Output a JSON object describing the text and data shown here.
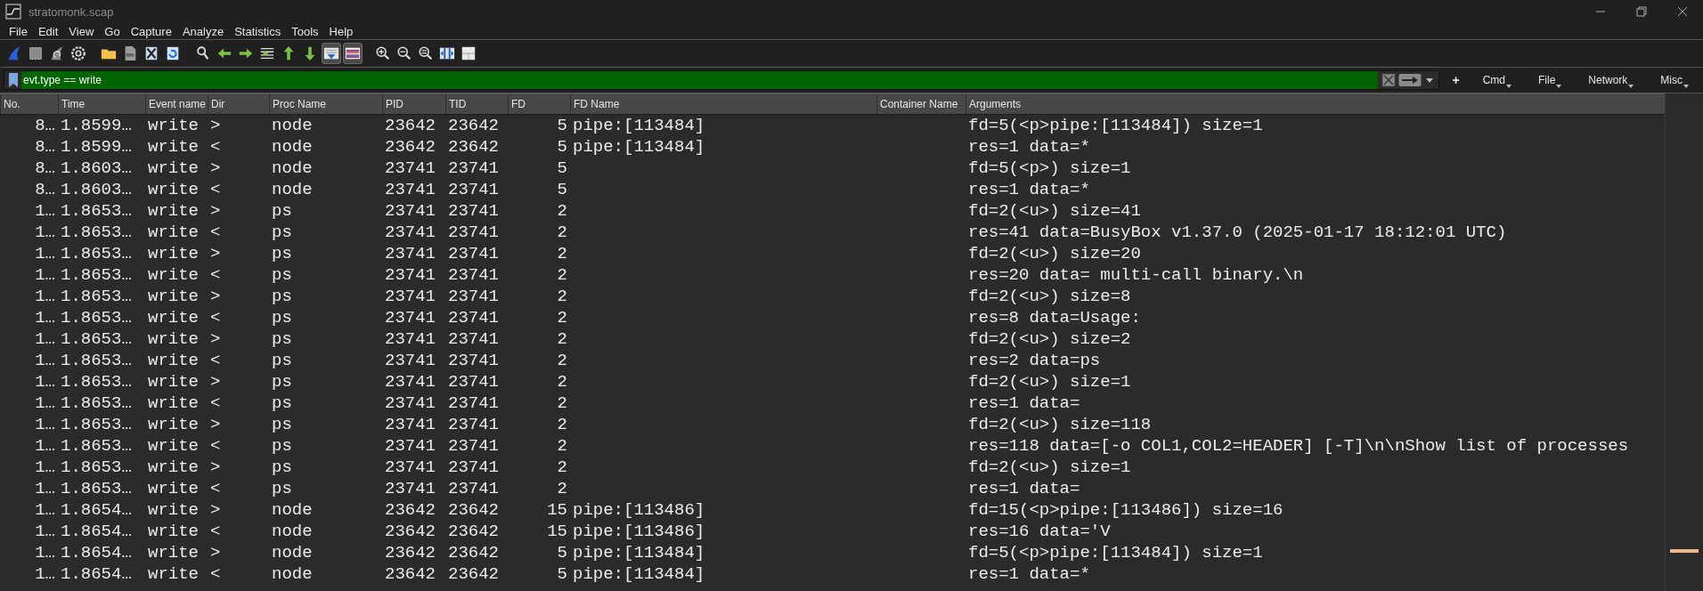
{
  "window": {
    "title": "stratomonk.scap"
  },
  "menu": [
    "File",
    "Edit",
    "View",
    "Go",
    "Capture",
    "Analyze",
    "Statistics",
    "Tools",
    "Help"
  ],
  "toolbar": [
    {
      "pressed": false
    },
    {
      "pressed": false
    },
    {
      "pressed": false
    },
    {
      "pressed": false
    },
    {
      "pressed": false
    },
    {
      "pressed": false
    },
    {
      "pressed": false
    },
    {
      "pressed": false
    },
    {
      "pressed": false
    },
    {
      "pressed": false
    },
    {
      "pressed": false
    },
    {
      "pressed": false
    },
    {
      "pressed": false
    },
    {
      "pressed": false
    },
    {
      "pressed": true
    },
    {
      "pressed": true
    },
    {
      "pressed": false
    },
    {
      "pressed": false
    },
    {
      "pressed": false
    },
    {
      "pressed": false
    },
    {
      "pressed": false
    }
  ],
  "filter": {
    "value": "evt.type == write",
    "add_label": "+",
    "buttons": [
      "Cmd",
      "File",
      "Network",
      "Misc"
    ]
  },
  "table": {
    "columns": [
      "No.",
      "Time",
      "Event name",
      "Dir",
      "Proc Name",
      "PID",
      "TID",
      "FD",
      "FD Name",
      "Container Name",
      "Arguments"
    ],
    "rows": [
      {
        "no": "8…",
        "time": "1.8599…",
        "event": "write",
        "dir": ">",
        "proc": "node",
        "pid": "23642",
        "tid": "23642",
        "fd": "5",
        "fd_name": "pipe:[113484]",
        "args": "fd=5(<p>pipe:[113484]) size=1"
      },
      {
        "no": "8…",
        "time": "1.8599…",
        "event": "write",
        "dir": "<",
        "proc": "node",
        "pid": "23642",
        "tid": "23642",
        "fd": "5",
        "fd_name": "pipe:[113484]",
        "args": "res=1 data=*"
      },
      {
        "no": "8…",
        "time": "1.8603…",
        "event": "write",
        "dir": ">",
        "proc": "node",
        "pid": "23741",
        "tid": "23741",
        "fd": "5",
        "args": "fd=5(<p>) size=1"
      },
      {
        "no": "8…",
        "time": "1.8603…",
        "event": "write",
        "dir": "<",
        "proc": "node",
        "pid": "23741",
        "tid": "23741",
        "fd": "5",
        "args": "res=1 data=*"
      },
      {
        "no": "1…",
        "time": "1.8653…",
        "event": "write",
        "dir": ">",
        "proc": "ps",
        "pid": "23741",
        "tid": "23741",
        "fd": "2",
        "args": "fd=2(<u>) size=41"
      },
      {
        "no": "1…",
        "time": "1.8653…",
        "event": "write",
        "dir": "<",
        "proc": "ps",
        "pid": "23741",
        "tid": "23741",
        "fd": "2",
        "args": "res=41 data=BusyBox v1.37.0 (2025-01-17 18:12:01 UTC)"
      },
      {
        "no": "1…",
        "time": "1.8653…",
        "event": "write",
        "dir": ">",
        "proc": "ps",
        "pid": "23741",
        "tid": "23741",
        "fd": "2",
        "args": "fd=2(<u>) size=20"
      },
      {
        "no": "1…",
        "time": "1.8653…",
        "event": "write",
        "dir": "<",
        "proc": "ps",
        "pid": "23741",
        "tid": "23741",
        "fd": "2",
        "args": "res=20 data= multi-call binary.\\n"
      },
      {
        "no": "1…",
        "time": "1.8653…",
        "event": "write",
        "dir": ">",
        "proc": "ps",
        "pid": "23741",
        "tid": "23741",
        "fd": "2",
        "args": "fd=2(<u>) size=8"
      },
      {
        "no": "1…",
        "time": "1.8653…",
        "event": "write",
        "dir": "<",
        "proc": "ps",
        "pid": "23741",
        "tid": "23741",
        "fd": "2",
        "args": "res=8 data=Usage:"
      },
      {
        "no": "1…",
        "time": "1.8653…",
        "event": "write",
        "dir": ">",
        "proc": "ps",
        "pid": "23741",
        "tid": "23741",
        "fd": "2",
        "args": "fd=2(<u>) size=2"
      },
      {
        "no": "1…",
        "time": "1.8653…",
        "event": "write",
        "dir": "<",
        "proc": "ps",
        "pid": "23741",
        "tid": "23741",
        "fd": "2",
        "args": "res=2 data=ps"
      },
      {
        "no": "1…",
        "time": "1.8653…",
        "event": "write",
        "dir": ">",
        "proc": "ps",
        "pid": "23741",
        "tid": "23741",
        "fd": "2",
        "args": "fd=2(<u>) size=1"
      },
      {
        "no": "1…",
        "time": "1.8653…",
        "event": "write",
        "dir": "<",
        "proc": "ps",
        "pid": "23741",
        "tid": "23741",
        "fd": "2",
        "args": "res=1 data="
      },
      {
        "no": "1…",
        "time": "1.8653…",
        "event": "write",
        "dir": ">",
        "proc": "ps",
        "pid": "23741",
        "tid": "23741",
        "fd": "2",
        "args": "fd=2(<u>) size=118"
      },
      {
        "no": "1…",
        "time": "1.8653…",
        "event": "write",
        "dir": "<",
        "proc": "ps",
        "pid": "23741",
        "tid": "23741",
        "fd": "2",
        "args": "res=118 data=[-o COL1,COL2=HEADER] [-T]\\n\\nShow list of processes"
      },
      {
        "no": "1…",
        "time": "1.8653…",
        "event": "write",
        "dir": ">",
        "proc": "ps",
        "pid": "23741",
        "tid": "23741",
        "fd": "2",
        "args": "fd=2(<u>) size=1"
      },
      {
        "no": "1…",
        "time": "1.8653…",
        "event": "write",
        "dir": "<",
        "proc": "ps",
        "pid": "23741",
        "tid": "23741",
        "fd": "2",
        "args": "res=1 data="
      },
      {
        "no": "1…",
        "time": "1.8654…",
        "event": "write",
        "dir": ">",
        "proc": "node",
        "pid": "23642",
        "tid": "23642",
        "fd": "15",
        "fd_name": "pipe:[113486]",
        "args": "fd=15(<p>pipe:[113486]) size=16"
      },
      {
        "no": "1…",
        "time": "1.8654…",
        "event": "write",
        "dir": "<",
        "proc": "node",
        "pid": "23642",
        "tid": "23642",
        "fd": "15",
        "fd_name": "pipe:[113486]",
        "args": "res=16 data='V"
      },
      {
        "no": "1…",
        "time": "1.8654…",
        "event": "write",
        "dir": ">",
        "proc": "node",
        "pid": "23642",
        "tid": "23642",
        "fd": "5",
        "fd_name": "pipe:[113484]",
        "args": "fd=5(<p>pipe:[113484]) size=1"
      },
      {
        "no": "1…",
        "time": "1.8654…",
        "event": "write",
        "dir": "<",
        "proc": "node",
        "pid": "23642",
        "tid": "23642",
        "fd": "5",
        "fd_name": "pipe:[113484]",
        "args": "res=1 data=*"
      }
    ]
  }
}
